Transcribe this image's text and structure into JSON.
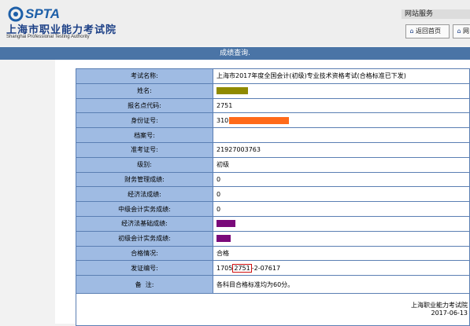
{
  "header": {
    "logo_text": "SPTA",
    "org_cn": "上海市职业能力考试院",
    "org_en": "Shanghai Professional Testing Authority",
    "service_title": "网站服务",
    "home_button": "返回首页",
    "cut_button": "网"
  },
  "titlebar": {
    "title": "成绩查询."
  },
  "rows": [
    {
      "label": "考试名称:",
      "value": "上海市2017年度全国会计(初级)专业技术资格考试(合格标准已下发)"
    },
    {
      "label": "姓名:",
      "value": ""
    },
    {
      "label": "报名点代码:",
      "value": "2751"
    },
    {
      "label": "身份证号:",
      "value": "310"
    },
    {
      "label": "档案号:",
      "value": ""
    },
    {
      "label": "准考证号:",
      "value": "21927003763"
    },
    {
      "label": "级别:",
      "value": "初级"
    },
    {
      "label": "财务管理成绩:",
      "value": "0"
    },
    {
      "label": "经济法成绩:",
      "value": "0"
    },
    {
      "label": "中级会计实务成绩:",
      "value": "0"
    },
    {
      "label": "经济法基础成绩:",
      "value": ""
    },
    {
      "label": "初级会计实务成绩:",
      "value": ""
    },
    {
      "label": "合格情况:",
      "value": "合格"
    },
    {
      "label": "发证编号:",
      "value_prefix": "1705",
      "value_boxed": "2751",
      "value_suffix": "-2-07617"
    },
    {
      "label": "备  注:",
      "value": "各科目合格标准均为60分。"
    }
  ],
  "footer": {
    "org": "上海职业能力考试院",
    "date": "2017-06-13"
  },
  "colors": {
    "label_bg": "#9fbbe3",
    "titlebar_bg": "#4a74a6",
    "border": "#5b7fb3",
    "redact_olive": "#8f8a00",
    "redact_orange": "#ff6a1a",
    "redact_purple": "#7a0a7a"
  }
}
